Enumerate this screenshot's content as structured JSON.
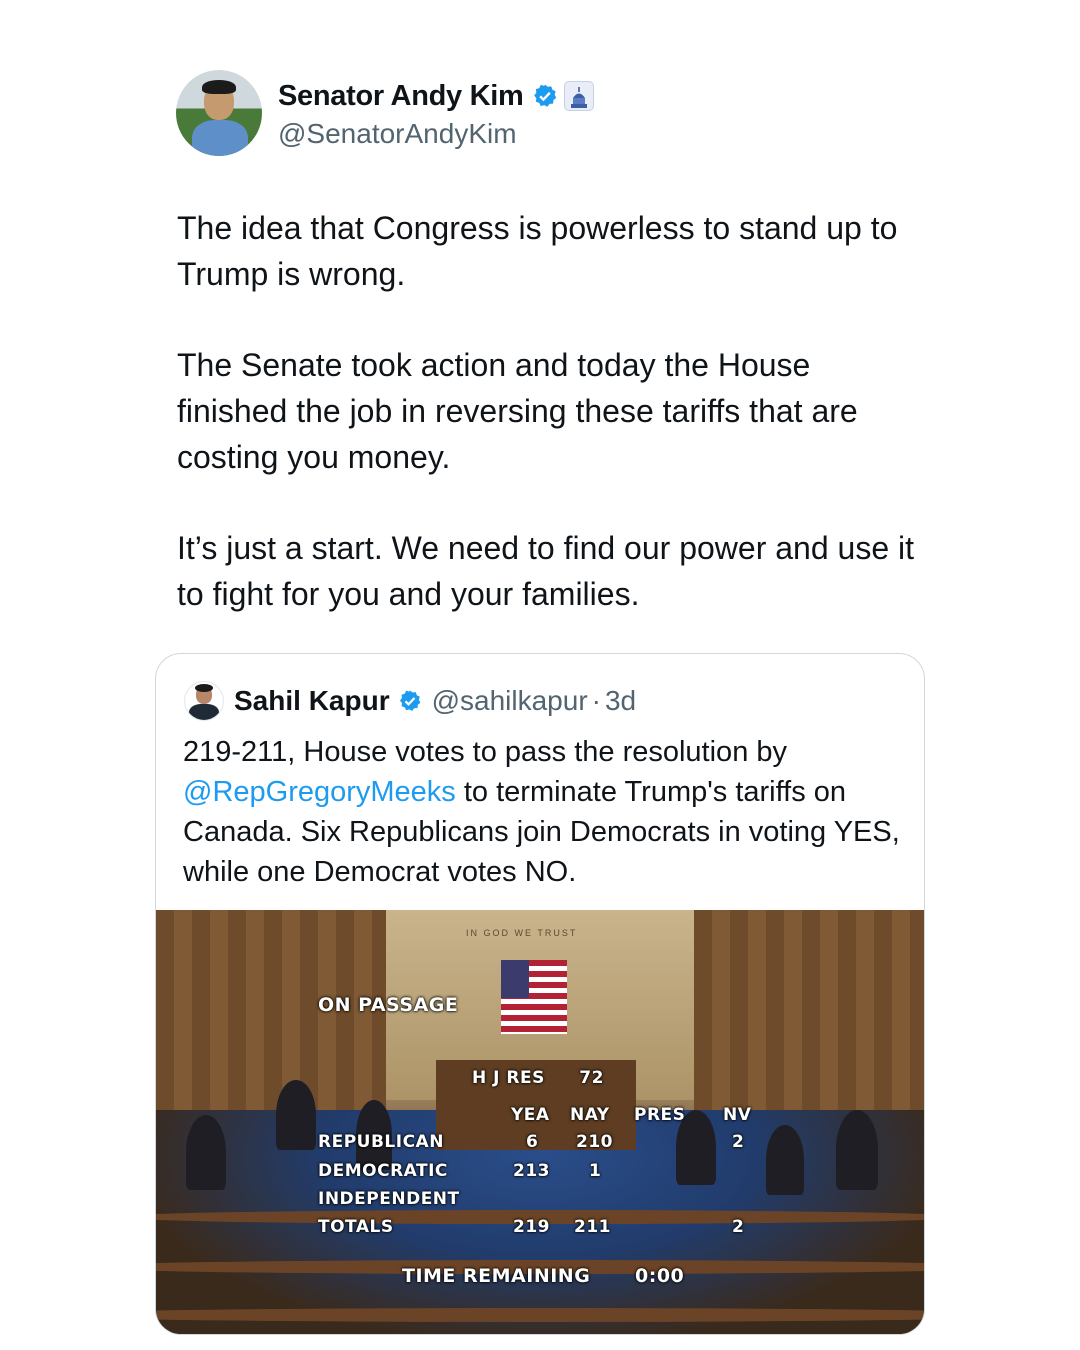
{
  "post": {
    "author": {
      "display_name": "Senator Andy Kim",
      "handle": "@SenatorAndyKim",
      "verified_icon": "verified-badge-icon",
      "affiliation_icon": "capitol-affiliation-icon"
    },
    "paragraphs": [
      "The idea that Congress is powerless to stand up to Trump is wrong.",
      "The Senate took action and today the House finished the job in reversing these tariffs that are costing you money.",
      "It’s just a start. We need to find our power and use it to fight for you and your families."
    ]
  },
  "quote": {
    "author": {
      "display_name": "Sahil Kapur",
      "handle": "@sahilkapur",
      "separator": "·",
      "time": "3d"
    },
    "text_before": "219-211, House votes to pass the resolution by ",
    "mention": "@RepGregoryMeeks",
    "text_after": " to terminate Trump's tariffs on Canada. Six Republicans join Democrats in voting YES, while one Democrat votes NO.",
    "media": {
      "motto": "IN GOD WE TRUST",
      "on_passage": "ON PASSAGE",
      "measure": "H J RES",
      "measure_number": "72",
      "headers": [
        "YEA",
        "NAY",
        "PRES",
        "NV"
      ],
      "rows": [
        {
          "party": "REPUBLICAN",
          "yea": "6",
          "nay": "210",
          "pres": "",
          "nv": "2"
        },
        {
          "party": "DEMOCRATIC",
          "yea": "213",
          "nay": "1",
          "pres": "",
          "nv": ""
        },
        {
          "party": "INDEPENDENT",
          "yea": "",
          "nay": "",
          "pres": "",
          "nv": ""
        },
        {
          "party": "TOTALS",
          "yea": "219",
          "nay": "211",
          "pres": "",
          "nv": "2"
        }
      ],
      "time_label": "TIME REMAINING",
      "time_value": "0:00"
    }
  },
  "colors": {
    "text": "#0f1419",
    "secondary": "#536471",
    "link": "#1d9bf0",
    "verified": "#1d9bf0",
    "border": "#cfd9de"
  }
}
